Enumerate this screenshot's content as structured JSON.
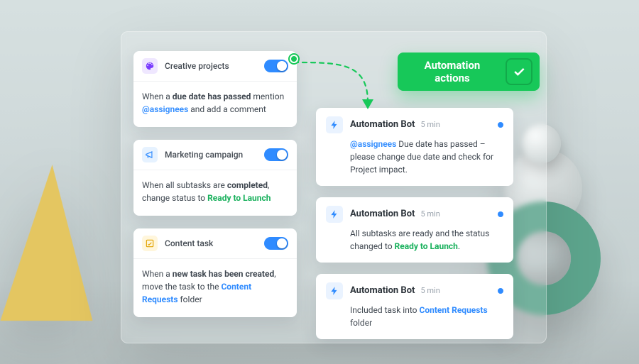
{
  "rules": [
    {
      "icon": "palette-icon",
      "title": "Creative projects",
      "body_pre": "When a ",
      "body_bold": "due date has passed",
      "body_mid": " mention ",
      "mention": "@assignees",
      "body_post": " and add a comment"
    },
    {
      "icon": "megaphone-icon",
      "title": "Marketing campaign",
      "body_pre": "When all subtasks are ",
      "body_bold": "completed",
      "body_mid": ", change status to ",
      "status": "Ready to Launch"
    },
    {
      "icon": "pencil-square-icon",
      "title": "Content task",
      "body_pre": "When a ",
      "body_bold": "new task has been created",
      "body_mid": ", move the task to the ",
      "folder": "Content Requests",
      "body_post": " folder"
    }
  ],
  "actions_chip": {
    "line1": "Automation",
    "line2": "actions"
  },
  "bots": [
    {
      "name": "Automation Bot",
      "time": "5 min",
      "mention": "@assignees",
      "body": " Due date has passed – please change due date and check for Project impact."
    },
    {
      "name": "Automation Bot",
      "time": "5 min",
      "body_pre": "All subtasks are ready and the status changed to ",
      "status": "Ready to Launch",
      "body_post": "."
    },
    {
      "name": "Automation Bot",
      "time": "5 min",
      "body_pre": "Included task into ",
      "folder": "Content Requests",
      "body_post": " folder"
    }
  ]
}
